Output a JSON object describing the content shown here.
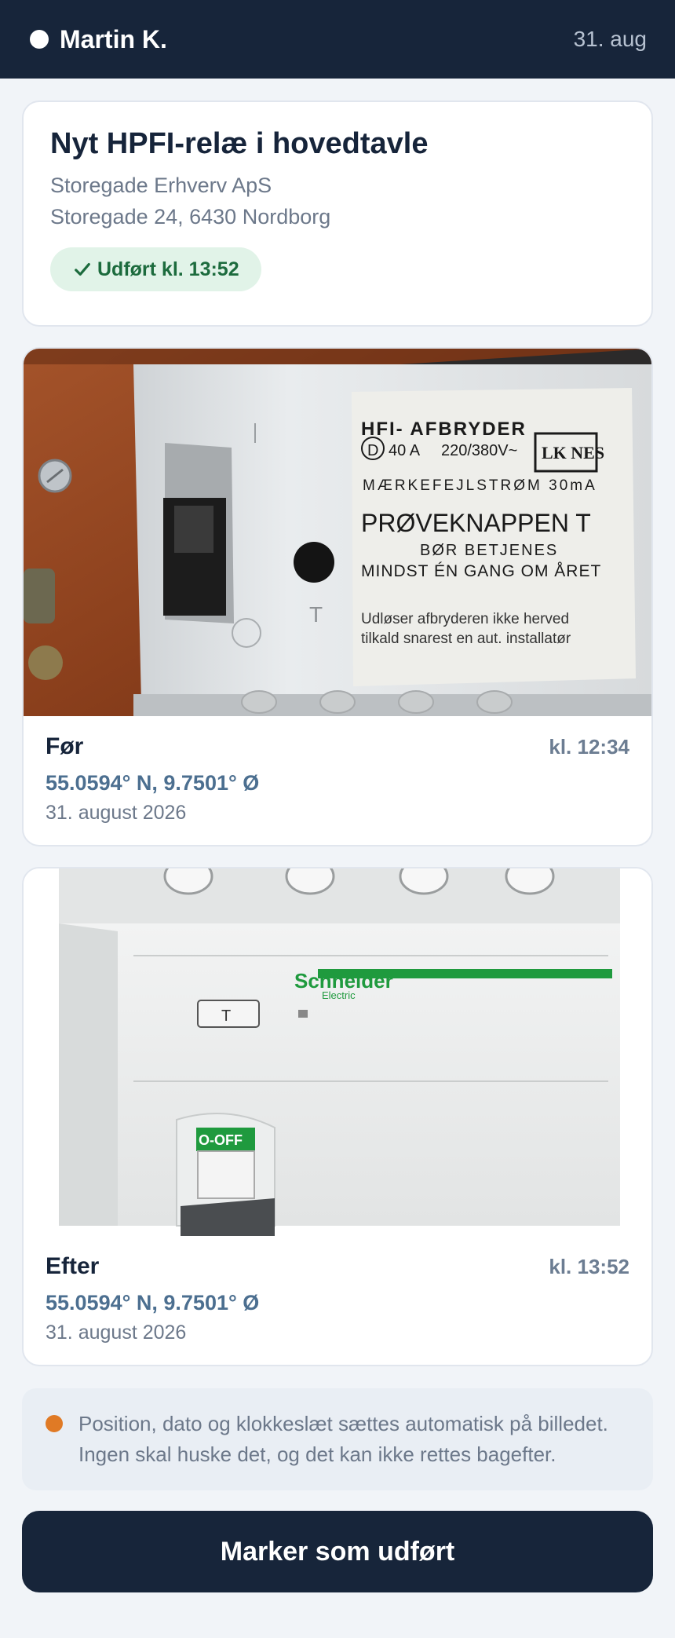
{
  "header": {
    "user_name": "Martin K.",
    "date": "31. aug"
  },
  "job": {
    "title": "Nyt HPFI-relæ i hovedtavle",
    "company": "Storegade Erhverv ApS",
    "address": "Storegade 24, 6430 Nordborg",
    "status": "Udført kl. 13:52"
  },
  "photos": [
    {
      "label": "Før",
      "time": "kl. 12:34",
      "coords": "55.0594° N, 9.7501° Ø",
      "date": "31. august 2026",
      "photo_text": {
        "l1": "HFI- AFBRYDER",
        "l2": "D",
        "l3": "40 A",
        "l4": "220/380V~",
        "logo": "LK NES",
        "l5": "MÆRKEFEJLSTRØM 30mA",
        "l6": "PRØVEKNAPPEN T",
        "l7": "BØR BETJENES",
        "l8": "MINDST ÉN GANG OM ÅRET",
        "l9": "Udløser afbryderen ikke herved",
        "l10": "tilkald snarest en aut. installatør",
        "button_mark": "T"
      }
    },
    {
      "label": "Efter",
      "time": "kl. 13:52",
      "coords": "55.0594° N, 9.7501° Ø",
      "date": "31. august 2026",
      "photo_text": {
        "brand": "Schneider",
        "brand_sub": "Electric",
        "test": "T",
        "off": "O-OFF"
      }
    }
  ],
  "note": {
    "text": "Position, dato og klokkeslæt sættes automatisk på billedet. Ingen skal huske det, og det kan ikke rettes bagefter."
  },
  "cta": {
    "label": "Marker som udført"
  },
  "colors": {
    "header_bg": "#17253a",
    "success_bg": "#e1f3e8",
    "success_text": "#1c6b3d",
    "coords_blue": "#4c6f90",
    "note_dot": "#e07a25"
  }
}
